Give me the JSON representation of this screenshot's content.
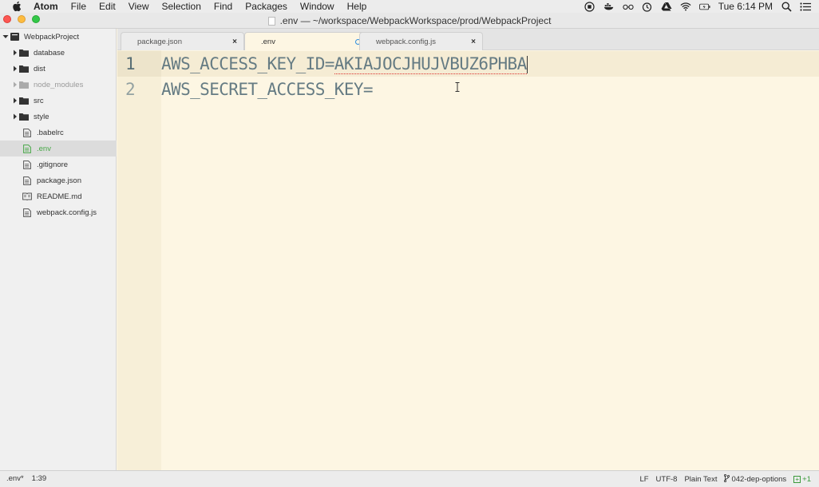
{
  "menubar": {
    "app_name": "Atom",
    "items": [
      "File",
      "Edit",
      "View",
      "Selection",
      "Find",
      "Packages",
      "Window",
      "Help"
    ],
    "clock": "Tue 6:14 PM"
  },
  "window": {
    "title": ".env — ~/workspace/WebpackWorkspace/prod/WebpackProject"
  },
  "tree": {
    "project": "WebpackProject",
    "items": [
      {
        "label": "database",
        "type": "folder"
      },
      {
        "label": "dist",
        "type": "folder"
      },
      {
        "label": "node_modules",
        "type": "folder-ignored"
      },
      {
        "label": "src",
        "type": "folder"
      },
      {
        "label": "style",
        "type": "folder"
      },
      {
        "label": ".babelrc",
        "type": "file"
      },
      {
        "label": ".env",
        "type": "file-active"
      },
      {
        "label": ".gitignore",
        "type": "file"
      },
      {
        "label": "package.json",
        "type": "file"
      },
      {
        "label": "README.md",
        "type": "markdown"
      },
      {
        "label": "webpack.config.js",
        "type": "file"
      }
    ]
  },
  "tabs": [
    {
      "label": "package.json",
      "state": "closable"
    },
    {
      "label": ".env",
      "state": "modified",
      "active": true
    },
    {
      "label": "webpack.config.js",
      "state": "closable"
    }
  ],
  "editor": {
    "lines": [
      {
        "number": "1",
        "key": "AWS_ACCESS_KEY_ID=",
        "value": "AKIAJOCJHUJVBUZ6PHBA"
      },
      {
        "number": "2",
        "key": "AWS_SECRET_ACCESS_KEY=",
        "value": ""
      }
    ]
  },
  "statusbar": {
    "file": ".env*",
    "cursor": "1:39",
    "line_ending": "LF",
    "encoding": "UTF-8",
    "grammar": "Plain Text",
    "branch": "042-dep-options",
    "git_added": "+1"
  },
  "colors": {
    "editor_bg": "#fdf6e3",
    "active_file": "#47a847",
    "modified_dot": "#2e8ee0"
  }
}
